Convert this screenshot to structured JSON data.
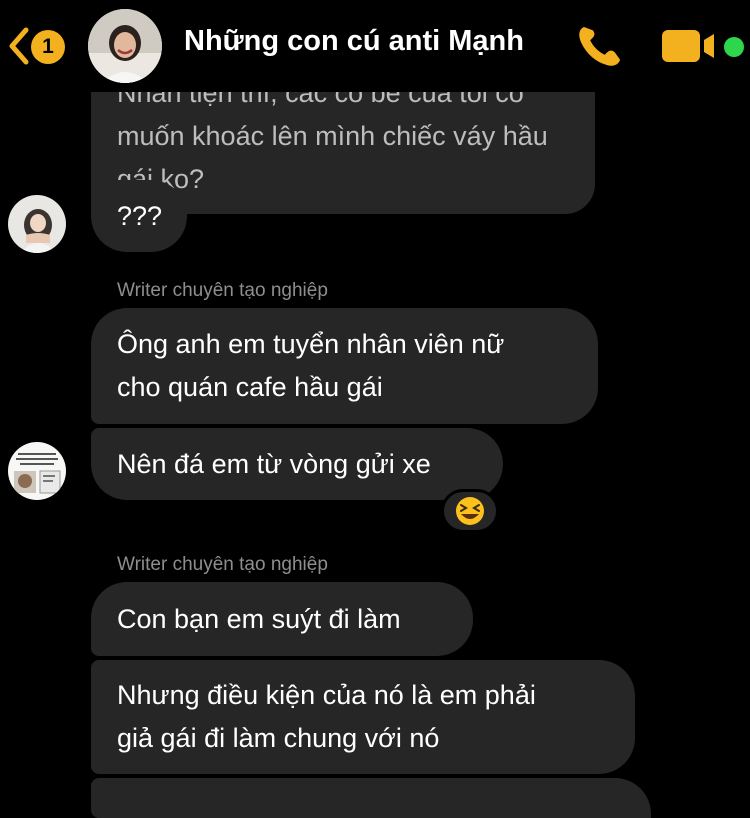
{
  "header": {
    "unread_badge": "1",
    "title": "Những con cú anti Mạnh",
    "accent_color": "#f3b11f",
    "online_color": "#2dd64b",
    "icons": [
      "back-chevron-icon",
      "phone-icon",
      "video-camera-icon"
    ]
  },
  "messages": [
    {
      "id": "m1",
      "lines": [
        "Nhân tiện thì, các cô bé của tôi có",
        "muốn khoác lên mình chiếc váy hầu",
        "gái ko?"
      ]
    },
    {
      "id": "m2",
      "lines": [
        "???"
      ]
    },
    {
      "id": "m3",
      "sender": "Writer chuyên tạo nghiệp",
      "lines": [
        "Ông anh em tuyển nhân viên nữ",
        "cho quán cafe hầu gái"
      ]
    },
    {
      "id": "m4",
      "lines": [
        "Nên đá em từ vòng gửi xe"
      ],
      "reaction": "laughing-face-emoji"
    },
    {
      "id": "m5",
      "sender": "Writer chuyên tạo nghiệp",
      "lines": [
        "Con bạn em suýt đi làm"
      ]
    },
    {
      "id": "m6",
      "lines": [
        "Nhưng điều kiện của nó là em phải",
        "giả gái đi làm chung với nó"
      ]
    }
  ]
}
